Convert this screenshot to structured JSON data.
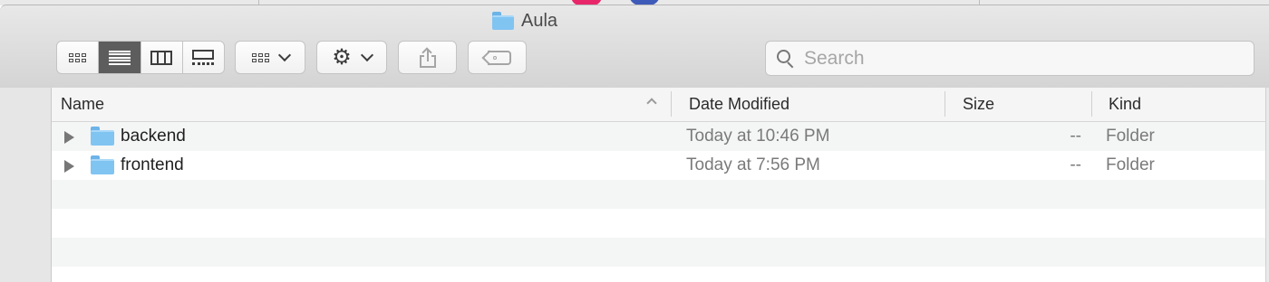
{
  "window": {
    "title": "Aula"
  },
  "toolbar": {
    "view_modes": [
      "icon-view",
      "list-view",
      "column-view",
      "gallery-view"
    ],
    "active_view": "list-view",
    "group_button": "group-by",
    "action_button": "action-gear",
    "share_button": "share",
    "tag_button": "tags"
  },
  "search": {
    "placeholder": "Search",
    "value": ""
  },
  "columns": {
    "name": "Name",
    "date": "Date Modified",
    "size": "Size",
    "kind": "Kind"
  },
  "files": [
    {
      "name": "backend",
      "date": "Today at 10:46 PM",
      "size": "--",
      "kind": "Folder"
    },
    {
      "name": "frontend",
      "date": "Today at 7:56 PM",
      "size": "--",
      "kind": "Folder"
    }
  ],
  "colors": {
    "folder": "#80c4f2",
    "active_segment": "#5d5d5d",
    "pink_deco": "#e8276b",
    "blue_deco": "#3f5bb9"
  }
}
